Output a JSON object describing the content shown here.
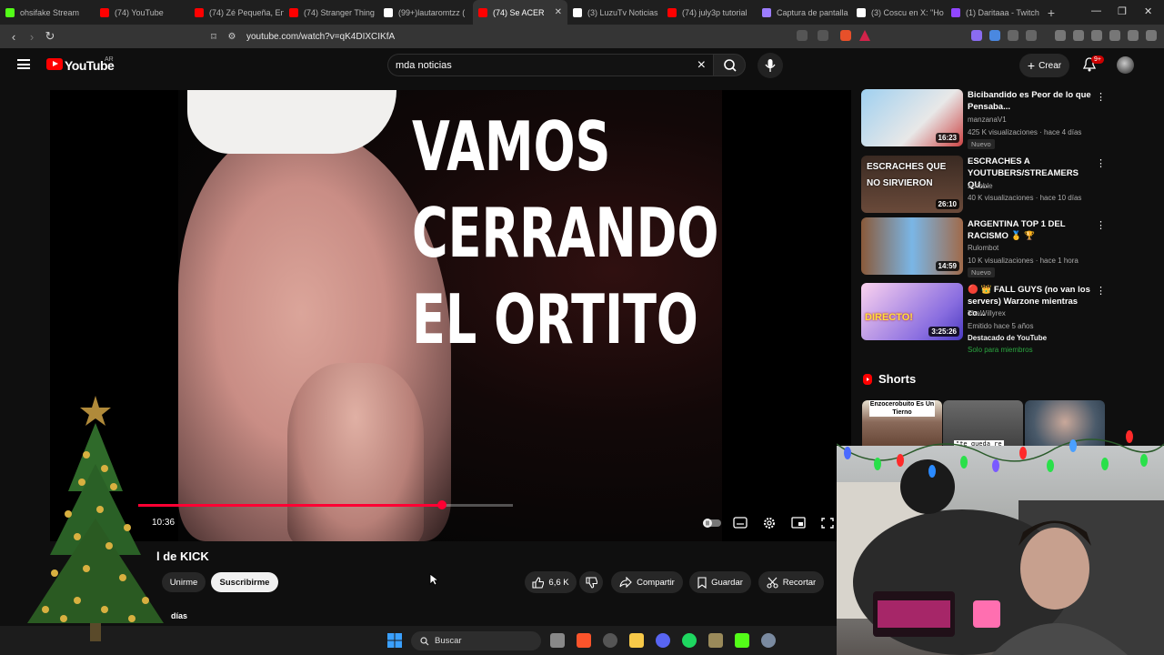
{
  "browser": {
    "tabs": [
      {
        "label": "ohsifake Stream",
        "color": "#53fc18"
      },
      {
        "label": "(74) YouTube",
        "color": "#ff0000"
      },
      {
        "label": "(74) Zé Pequeña, En",
        "color": "#ff0000"
      },
      {
        "label": "(74) Stranger Thing",
        "color": "#ff0000"
      },
      {
        "label": "(99+)lautaromtzz (",
        "color": "#ffffff"
      },
      {
        "label": "(74) Se ACER",
        "color": "#ff0000"
      },
      {
        "label": "(3) LuzuTv Noticias",
        "color": "#ffffff"
      },
      {
        "label": "(74) july3p tutorial",
        "color": "#ff0000"
      },
      {
        "label": "Captura de pantalla",
        "color": "#9c7cff"
      },
      {
        "label": "(3) Coscu en X: \"Ho",
        "color": "#ffffff"
      },
      {
        "label": "(1) Daritaaa - Twitch",
        "color": "#9146ff"
      }
    ],
    "url": "youtube.com/watch?v=qK4DIXCIKfA"
  },
  "youtube": {
    "logo_text": "YouTube",
    "country_code": "AR",
    "search_value": "mda noticias",
    "create_label": "Crear",
    "notification_count": "9+"
  },
  "video": {
    "overlay_lines": [
      "VAMOS",
      "CERRANDO",
      "EL ORTITO"
    ],
    "time_current": "10:36",
    "progress": 0.81,
    "title": "l de KICK",
    "unsubscribe_label": "Unirme",
    "subscribe_label": "Suscribirme",
    "likes": "6,6 K",
    "share_label": "Compartir",
    "save_label": "Guardar",
    "clip_label": "Recortar",
    "desc_fragment": "días"
  },
  "recommendations": [
    {
      "title": "Bicibandido es Peor de lo que Pensaba...",
      "channel": "manzanaV1",
      "meta": "425 K visualizaciones · hace 4 días",
      "badge": "Nuevo",
      "duration": "16:23",
      "thumb_color": "#7fb8e6"
    },
    {
      "title": "ESCRACHES A YOUTUBERS/STREAMERS QU...",
      "channel": "scribble",
      "meta": "40 K visualizaciones · hace 10 días",
      "badge": "",
      "duration": "26:10",
      "thumb_color": "#5a3a2a",
      "thumb_text": "ESCRACHES QUE NO SIRVIERON"
    },
    {
      "title": "ARGENTINA TOP 1 DEL RACISMO 🥇 🏆",
      "channel": "Rulombot",
      "meta": "10 K visualizaciones · hace 1 hora",
      "badge": "Nuevo",
      "duration": "14:59",
      "thumb_color": "#6fa9d8"
    },
    {
      "title": "🔴 👑 FALL GUYS (no van los servers) Warzone mientras co...",
      "channel": "TheWillyrex",
      "meta": "Emitido hace 5 años",
      "extra": "Destacado de YouTube",
      "members": "Solo para miembros",
      "duration": "3:25:26",
      "thumb_color": "#f0a8e0",
      "thumb_text": "DIRECTO!"
    }
  ],
  "shorts": {
    "heading": "Shorts",
    "items": [
      {
        "label": "Enzocerobuito Es Un Tierno",
        "color": "#8a6a5a"
      },
      {
        "label": "\"te queda re",
        "color": "#4a4a4a"
      },
      {
        "label": "",
        "color": "#6a7a8a"
      }
    ]
  },
  "taskbar": {
    "search_label": "Buscar"
  }
}
